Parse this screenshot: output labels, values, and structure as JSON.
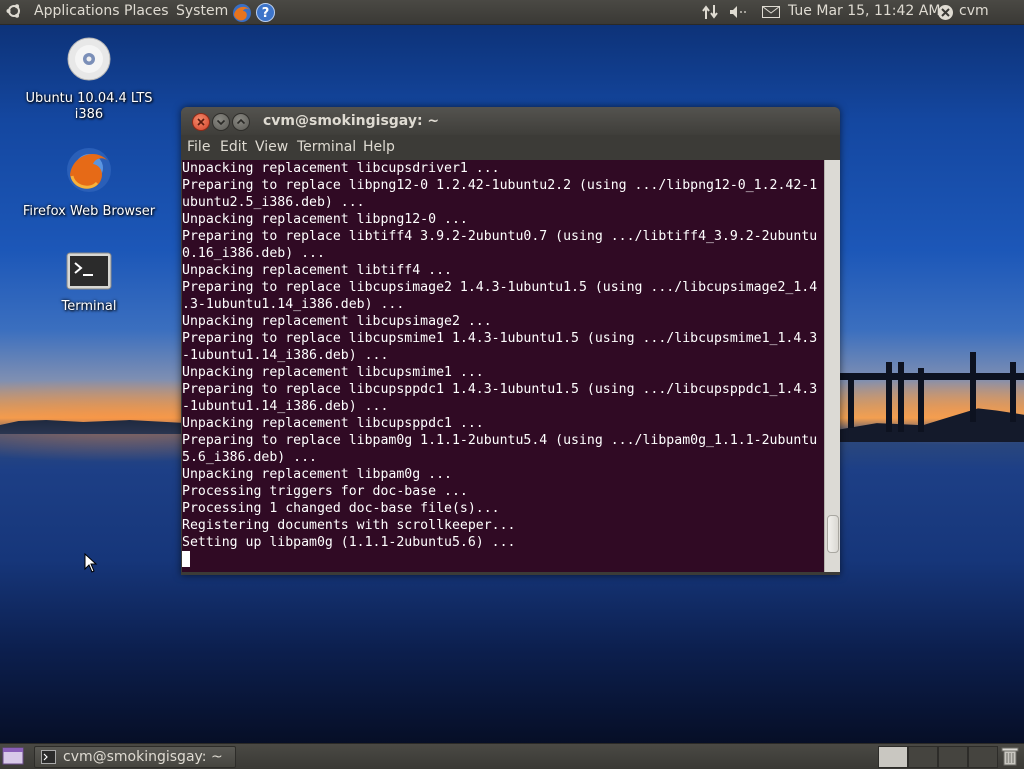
{
  "top_panel": {
    "menus": [
      "Applications",
      "Places",
      "System"
    ],
    "clock": "Tue Mar 15, 11:42 AM",
    "user": "cvm",
    "icons": [
      "ubuntu-logo-icon",
      "firefox-icon",
      "help-icon",
      "network-icon",
      "volume-icon",
      "mail-icon",
      "session-icon"
    ]
  },
  "desktop": {
    "icons": [
      {
        "label_line1": "Ubuntu 10.04.4 LTS",
        "label_line2": "i386",
        "icon": "cd-disc-icon"
      },
      {
        "label": "Firefox Web Browser",
        "icon": "firefox-icon"
      },
      {
        "label": "Terminal",
        "icon": "terminal-icon"
      }
    ]
  },
  "terminal": {
    "title": "cvm@smokingisgay: ~",
    "menu": [
      "File",
      "Edit",
      "View",
      "Terminal",
      "Help"
    ],
    "lines": [
      "Unpacking replacement libcupsdriver1 ...",
      "Preparing to replace libpng12-0 1.2.42-1ubuntu2.2 (using .../libpng12-0_1.2.42-1",
      "ubuntu2.5_i386.deb) ...",
      "Unpacking replacement libpng12-0 ...",
      "Preparing to replace libtiff4 3.9.2-2ubuntu0.7 (using .../libtiff4_3.9.2-2ubuntu",
      "0.16_i386.deb) ...",
      "Unpacking replacement libtiff4 ...",
      "Preparing to replace libcupsimage2 1.4.3-1ubuntu1.5 (using .../libcupsimage2_1.4",
      ".3-1ubuntu1.14_i386.deb) ...",
      "Unpacking replacement libcupsimage2 ...",
      "Preparing to replace libcupsmime1 1.4.3-1ubuntu1.5 (using .../libcupsmime1_1.4.3",
      "-1ubuntu1.14_i386.deb) ...",
      "Unpacking replacement libcupsmime1 ...",
      "Preparing to replace libcupsppdc1 1.4.3-1ubuntu1.5 (using .../libcupsppdc1_1.4.3",
      "-1ubuntu1.14_i386.deb) ...",
      "Unpacking replacement libcupsppdc1 ...",
      "Preparing to replace libpam0g 1.1.1-2ubuntu5.4 (using .../libpam0g_1.1.1-2ubuntu",
      "5.6_i386.deb) ...",
      "Unpacking replacement libpam0g ...",
      "Processing triggers for doc-base ...",
      "Processing 1 changed doc-base file(s)...",
      "Registering documents with scrollkeeper...",
      "Setting up libpam0g (1.1.1-2ubuntu5.6) ..."
    ]
  },
  "bottom_panel": {
    "task_label": "cvm@smokingisgay: ~",
    "icons": [
      "show-desktop-icon",
      "terminal-icon",
      "trash-icon"
    ]
  },
  "colors": {
    "terminal_bg": "#300a24",
    "panel_bg": "#3c3b37",
    "close_button": "#d2442c"
  }
}
